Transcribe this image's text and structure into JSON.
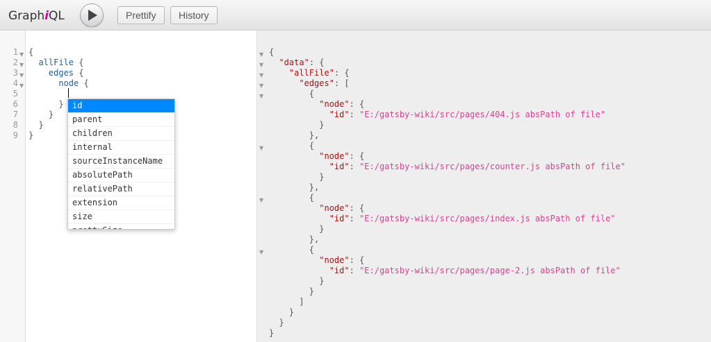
{
  "toolbar": {
    "logo_prefix": "Graph",
    "logo_italic": "i",
    "logo_suffix": "QL",
    "prettify_label": "Prettify",
    "history_label": "History"
  },
  "editor": {
    "line_numbers": [
      "1",
      "2",
      "3",
      "4",
      "5",
      "6",
      "7",
      "8",
      "9"
    ],
    "lines": [
      {
        "indent": "",
        "text": "{"
      },
      {
        "indent": "  ",
        "field": "allFile",
        "text": " {"
      },
      {
        "indent": "    ",
        "field": "edges",
        "text": " {"
      },
      {
        "indent": "      ",
        "field": "node",
        "text": " {"
      },
      {
        "indent": "",
        "text": ""
      },
      {
        "indent": "      ",
        "text": "}"
      },
      {
        "indent": "    ",
        "text": "}"
      },
      {
        "indent": "  ",
        "text": "}"
      },
      {
        "indent": "",
        "text": "}"
      }
    ]
  },
  "autocomplete": {
    "items": [
      "id",
      "parent",
      "children",
      "internal",
      "sourceInstanceName",
      "absolutePath",
      "relativePath",
      "extension",
      "size",
      "prettySize"
    ],
    "selected": "id"
  },
  "result": {
    "data_key": "\"data\"",
    "allfile_key": "\"allFile\"",
    "edges_key": "\"edges\"",
    "node_key": "\"node\"",
    "id_key": "\"id\"",
    "ids": [
      "\"E:/gatsby-wiki/src/pages/404.js absPath of file\"",
      "\"E:/gatsby-wiki/src/pages/counter.js absPath of file\"",
      "\"E:/gatsby-wiki/src/pages/index.js absPath of file\"",
      "\"E:/gatsby-wiki/src/pages/page-2.js absPath of file\""
    ]
  }
}
